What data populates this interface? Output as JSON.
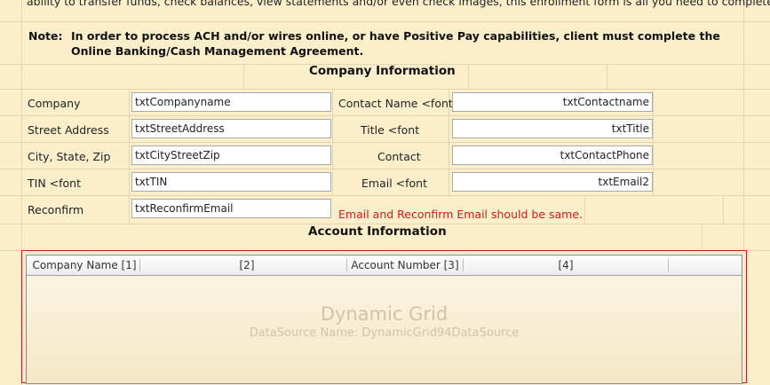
{
  "intro_text": "ability to transfer funds, check balances, view statements and/or even check images, this enrollment form is all you need to complete.",
  "note": {
    "label": "Note:",
    "text": "In order to process ACH and/or wires online, or have Positive Pay capabilities, client must complete the Online Banking/Cash Management Agreement."
  },
  "company_section": {
    "title": "Company Information",
    "left_labels": {
      "company": "Company",
      "street": "Street Address",
      "city": "City, State, Zip",
      "tin": "TIN <font",
      "reconfirm": "Reconfirm"
    },
    "left_fields": {
      "company": "txtCompanyname",
      "street": "txtStreetAddress",
      "city": "txtCityStreetZip",
      "tin": "txtTIN",
      "reconfirm": "txtReconfirmEmail"
    },
    "right_labels": {
      "contact_name": "Contact Name  <font",
      "title": "Title <font",
      "contact": "Contact",
      "email": "Email  <font"
    },
    "right_fields": {
      "contact_name": "txtContactname",
      "title": "txtTitle",
      "contact": "txtContactPhone",
      "email": "txtEmail2"
    },
    "validation_message": "Email and Reconfirm Email should be same."
  },
  "account_section": {
    "title": "Account Information",
    "grid": {
      "columns": [
        "Company Name [1]",
        "[2]",
        "Account Number [3]",
        "[4]"
      ],
      "placeholder_title": "Dynamic Grid",
      "placeholder_subtitle": "DataSource Name: DynamicGrid94DataSource"
    }
  },
  "colors": {
    "background": "#fbeecb",
    "error_text": "#d11a1a",
    "grid_border": "#c41a1a"
  }
}
